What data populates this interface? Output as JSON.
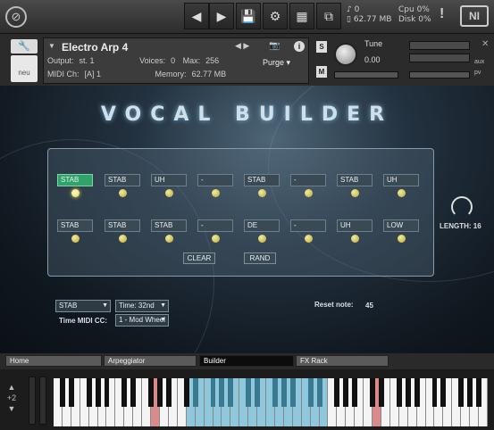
{
  "host": {
    "cpu_label": "Cpu",
    "cpu_value": "0%",
    "disk_label": "Disk",
    "disk_value": "0%",
    "voices_count": "0",
    "memory": "62.77 MB"
  },
  "header": {
    "instrument_name": "Electro Arp 4",
    "output_label": "Output:",
    "output_value": "st. 1",
    "voices_label": "Voices:",
    "voices_value": "0",
    "max_label": "Max:",
    "max_value": "256",
    "purge_label": "Purge",
    "midi_label": "MIDI Ch:",
    "midi_value": "[A]  1",
    "memory_label": "Memory:",
    "memory_value": "62.77 MB",
    "tune_label": "Tune",
    "tune_value": "0.00",
    "solo_label": "S",
    "mute_label": "M",
    "aux_label": "aux",
    "pv_label": "pv",
    "logo_text": "neu"
  },
  "stage": {
    "title": "VOCAL BUILDER",
    "row1": [
      "STAB",
      "STAB",
      "UH",
      "-",
      "STAB",
      "-",
      "STAB",
      "UH"
    ],
    "row2": [
      "STAB",
      "STAB",
      "STAB",
      "-",
      "DE",
      "-",
      "UH",
      "LOW"
    ],
    "active_step": 0,
    "clear_label": "CLEAR",
    "rand_label": "RAND",
    "length_label": "LENGTH: 16",
    "sample_dd": "STAB",
    "time_dd": "Time: 32nd",
    "time_midi_cc_label": "Time MIDI CC:",
    "midi_cc_dd": "1 - Mod Wheel",
    "reset_note_label": "Reset note:",
    "reset_note_value": "45"
  },
  "tabs": [
    "Home",
    "Arpeggiator",
    "Builder",
    "FX Rack"
  ],
  "selected_tab": 2,
  "keyboard": {
    "octave_value": "+2",
    "highlight_color": "#8fc8dc",
    "keyswitch_color": "#d98a8a"
  }
}
